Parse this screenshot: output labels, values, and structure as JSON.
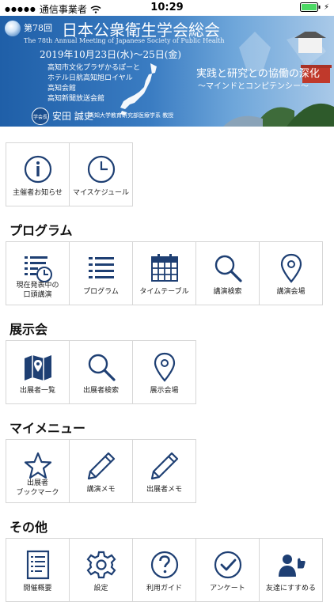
{
  "status_bar": {
    "carrier": "通信事業者",
    "time": "10:29"
  },
  "banner": {
    "edition_prefix": "第78回",
    "title": "日本公衆衛生学会総会",
    "subtitle": "The 78th Annual Meeting of Japanese Society of Public Health",
    "date": "2019年10月23日(水)～25日(金)",
    "venues": [
      "高知市文化プラザかるぽーと",
      "ホテル日航高知旭ロイヤル",
      "高知会館",
      "高知新聞放送会館"
    ],
    "theme_main": "実践と研究との協働の深化",
    "theme_sub": "～マインドとコンピテンシー～",
    "president_badge": "学会長",
    "president_name": "安田 誠史",
    "president_title": "高知大学教育研究部医療学系 教授"
  },
  "tiles_top": [
    {
      "label": "主催者お知らせ",
      "icon": "info-icon"
    },
    {
      "label": "マイスケジュール",
      "icon": "clock-icon"
    }
  ],
  "sections": {
    "program": {
      "title": "プログラム",
      "tiles": [
        {
          "label": "現在発表中の\n口頭講演",
          "icon": "list-clock-icon"
        },
        {
          "label": "プログラム",
          "icon": "list-icon"
        },
        {
          "label": "タイムテーブル",
          "icon": "calendar-icon"
        },
        {
          "label": "講演検索",
          "icon": "search-icon"
        },
        {
          "label": "講演会場",
          "icon": "map-pin-icon"
        }
      ]
    },
    "exhibition": {
      "title": "展示会",
      "tiles": [
        {
          "label": "出展者一覧",
          "icon": "map-icon"
        },
        {
          "label": "出展者検索",
          "icon": "search-icon"
        },
        {
          "label": "展示会場",
          "icon": "map-pin-icon"
        }
      ]
    },
    "mymenu": {
      "title": "マイメニュー",
      "tiles": [
        {
          "label": "出展者\nブックマーク",
          "icon": "star-icon"
        },
        {
          "label": "講演メモ",
          "icon": "pencil-icon"
        },
        {
          "label": "出展者メモ",
          "icon": "pencil-icon"
        }
      ]
    },
    "other": {
      "title": "その他",
      "tiles": [
        {
          "label": "開催概要",
          "icon": "document-icon"
        },
        {
          "label": "設定",
          "icon": "gear-icon"
        },
        {
          "label": "利用ガイド",
          "icon": "question-icon"
        },
        {
          "label": "アンケート",
          "icon": "check-icon"
        },
        {
          "label": "友達にすすめる",
          "icon": "recommend-icon"
        }
      ]
    }
  },
  "colors": {
    "icon": "#1e3f73",
    "tile_border": "#d6d6d6",
    "battery": "#4cd964"
  }
}
